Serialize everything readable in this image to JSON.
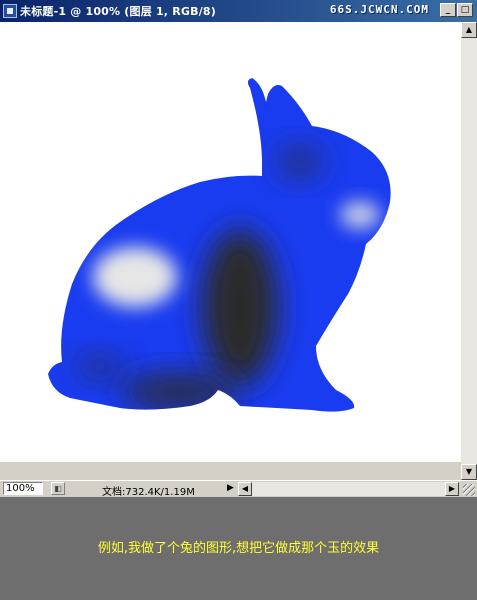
{
  "window": {
    "title": "未标题-1 @ 100% (图层 1, RGB/8)",
    "watermark": "66S.JCWCN.COM",
    "buttons": {
      "minimize": "_",
      "maximize": "□"
    }
  },
  "canvas": {
    "background": "#ffffff",
    "rabbit_color": "#1a3cf0",
    "cloud_dark": "#2a2a2a",
    "cloud_light": "#e6e6e6"
  },
  "status_bar": {
    "zoom": "100%",
    "doc_size": "文档:732.4K/1.19M",
    "menu_arrow": "▶"
  },
  "scrollbars": {
    "up": "▲",
    "down": "▼",
    "left": "◀",
    "right": "▶"
  },
  "caption": "例如,我做了个兔的图形,想把它做成那个玉的效果",
  "colors": {
    "titlebar_start": "#0a246a",
    "titlebar_end": "#3a6ea5",
    "chrome": "#d4d0c8",
    "lower_panel": "#6e6e6e",
    "caption_text": "#ffff33"
  }
}
